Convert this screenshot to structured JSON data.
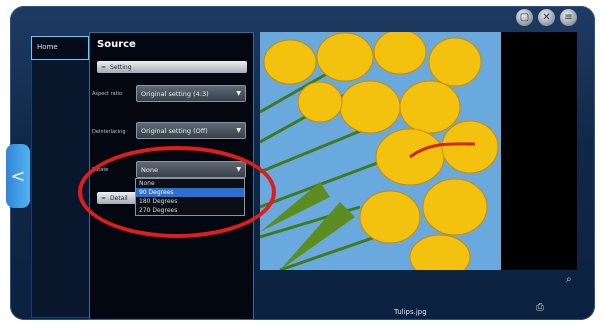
{
  "window": {
    "buttons": [
      {
        "icon": "document-icon",
        "glyph": "▢"
      },
      {
        "icon": "close-icon",
        "glyph": "✕"
      },
      {
        "icon": "menu-icon",
        "glyph": "≡"
      }
    ]
  },
  "sidebar": {
    "home_label": "Home",
    "back_arrow_glyph": "<"
  },
  "panel": {
    "title": "Source",
    "setting_section": {
      "label": "Setting",
      "toggle_glyph": "≈"
    },
    "aspect_ratio": {
      "label": "Aspect ratio",
      "value": "Original setting (4:3)"
    },
    "deinterlace": {
      "label": "Deinterlacing",
      "value": "Original setting (Off)"
    },
    "rotate": {
      "label": "Rotate",
      "value": "None",
      "options": [
        "None",
        "90 Degrees",
        "180 Degrees",
        "270 Degrees"
      ],
      "highlighted_index": 1
    },
    "detail_section": {
      "label": "Detail",
      "toggle_glyph": "≈"
    }
  },
  "preview": {
    "filename": "Tulips.jpg",
    "zoom_icon": "search-icon",
    "export_icon": "export-icon"
  },
  "annotation": {
    "color": "#e21c1c"
  }
}
